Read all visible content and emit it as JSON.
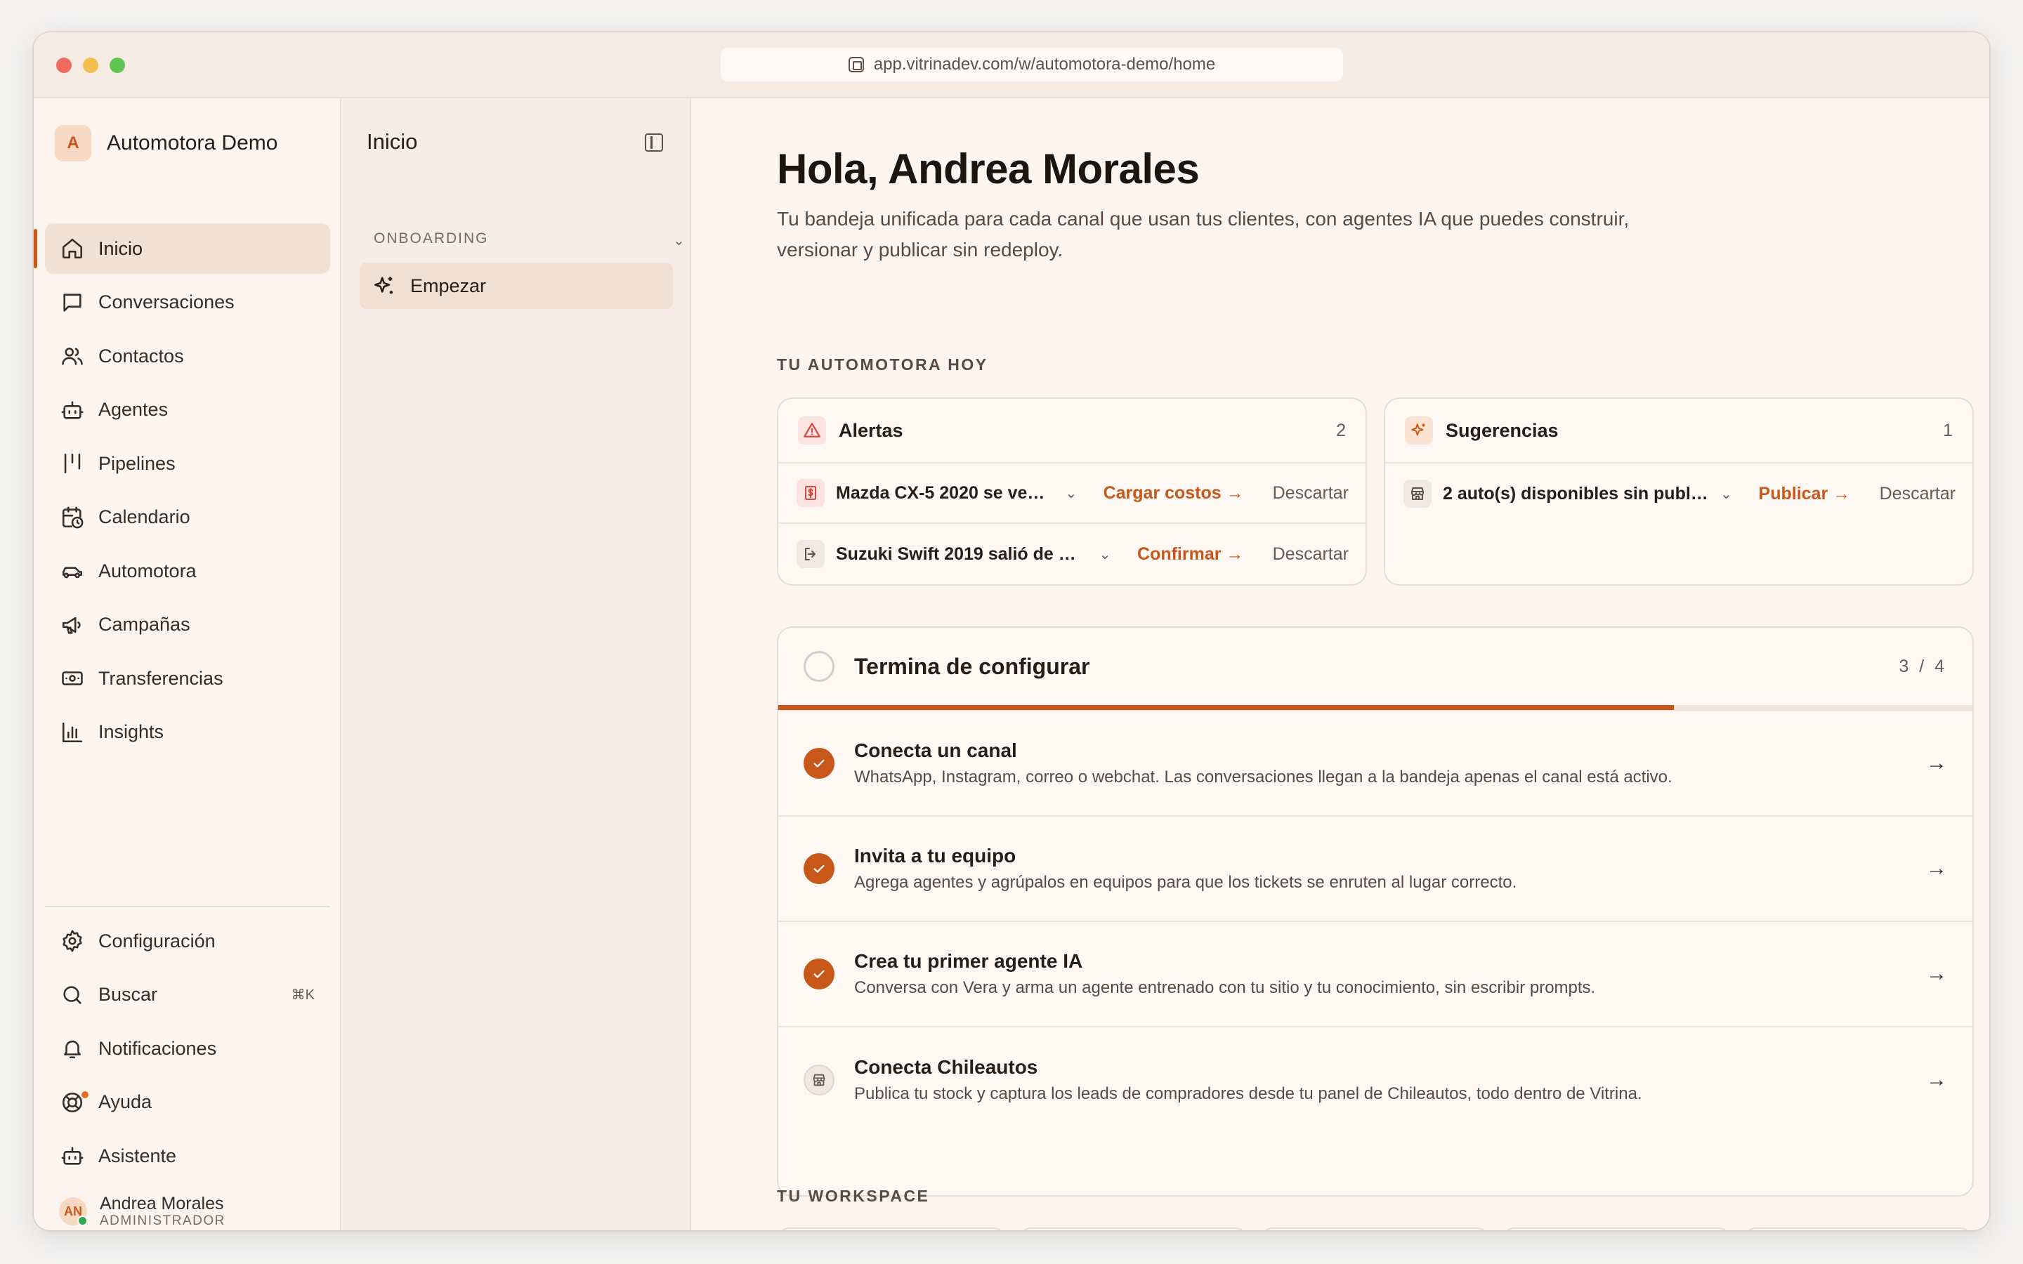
{
  "browser": {
    "url": "app.vitrinadev.com/w/automotora-demo/home"
  },
  "sidebar": {
    "brand_initial": "A",
    "brand_name": "Automotora Demo",
    "items": [
      {
        "label": "Inicio",
        "icon": "home-icon",
        "active": true
      },
      {
        "label": "Conversaciones",
        "icon": "message-icon"
      },
      {
        "label": "Contactos",
        "icon": "users-icon"
      },
      {
        "label": "Agentes",
        "icon": "bot-icon"
      },
      {
        "label": "Pipelines",
        "icon": "kanban-icon"
      },
      {
        "label": "Calendario",
        "icon": "calendar-icon"
      },
      {
        "label": "Automotora",
        "icon": "car-icon"
      },
      {
        "label": "Campañas",
        "icon": "megaphone-icon"
      },
      {
        "label": "Transferencias",
        "icon": "banknote-icon"
      },
      {
        "label": "Insights",
        "icon": "bar-chart-icon"
      }
    ],
    "bottom_items": [
      {
        "label": "Configuración",
        "icon": "gear-icon"
      },
      {
        "label": "Buscar",
        "icon": "search-icon",
        "shortcut": "⌘K"
      },
      {
        "label": "Notificaciones",
        "icon": "bell-icon"
      },
      {
        "label": "Ayuda",
        "icon": "lifebuoy-icon"
      },
      {
        "label": "Asistente",
        "icon": "assistant-icon"
      }
    ],
    "user": {
      "initials": "AN",
      "name": "Andrea Morales",
      "role": "ADMINISTRADOR"
    }
  },
  "pane": {
    "title": "Inicio",
    "section": "ONBOARDING",
    "item": "Empezar"
  },
  "main": {
    "greeting": "Hola, Andrea Morales",
    "subtitle": "Tu bandeja unificada para cada canal que usan tus clientes, con agentes IA que puedes construir, versionar y publicar sin redeploy.",
    "today_label": "TU AUTOMOTORA HOY",
    "alerts": {
      "title": "Alertas",
      "count": "2",
      "rows": [
        {
          "text": "Mazda CX-5 2020 se vendi…",
          "action": "Cargar costos →",
          "dismiss": "Descartar"
        },
        {
          "text": "Suzuki Swift 2019 salió de Mer…",
          "action": "Confirmar →",
          "dismiss": "Descartar"
        }
      ]
    },
    "suggestions": {
      "title": "Sugerencias",
      "count": "1",
      "rows": [
        {
          "text": "2 auto(s) disponibles sin publicar",
          "action": "Publicar →",
          "dismiss": "Descartar"
        }
      ]
    },
    "setup": {
      "title": "Termina de configurar",
      "count": "3 / 4",
      "progress": 0.75,
      "tasks": [
        {
          "title": "Conecta un canal",
          "desc": "WhatsApp, Instagram, correo o webchat. Las conversaciones llegan a la bandeja apenas el canal está activo.",
          "done": true
        },
        {
          "title": "Invita a tu equipo",
          "desc": "Agrega agentes y agrúpalos en equipos para que los tickets se enruten al lugar correcto.",
          "done": true
        },
        {
          "title": "Crea tu primer agente IA",
          "desc": "Conversa con Vera y arma un agente entrenado con tu sitio y tu conocimiento, sin escribir prompts.",
          "done": true
        },
        {
          "title": "Conecta Chileautos",
          "desc": "Publica tu stock y captura los leads de compradores desde tu panel de Chileautos, todo dentro de Vitrina.",
          "done": false
        }
      ]
    },
    "workspace_label": "TU WORKSPACE"
  },
  "colors": {
    "accent": "#c7581a",
    "background": "#fbf4ef",
    "border": "#eadbcf"
  }
}
